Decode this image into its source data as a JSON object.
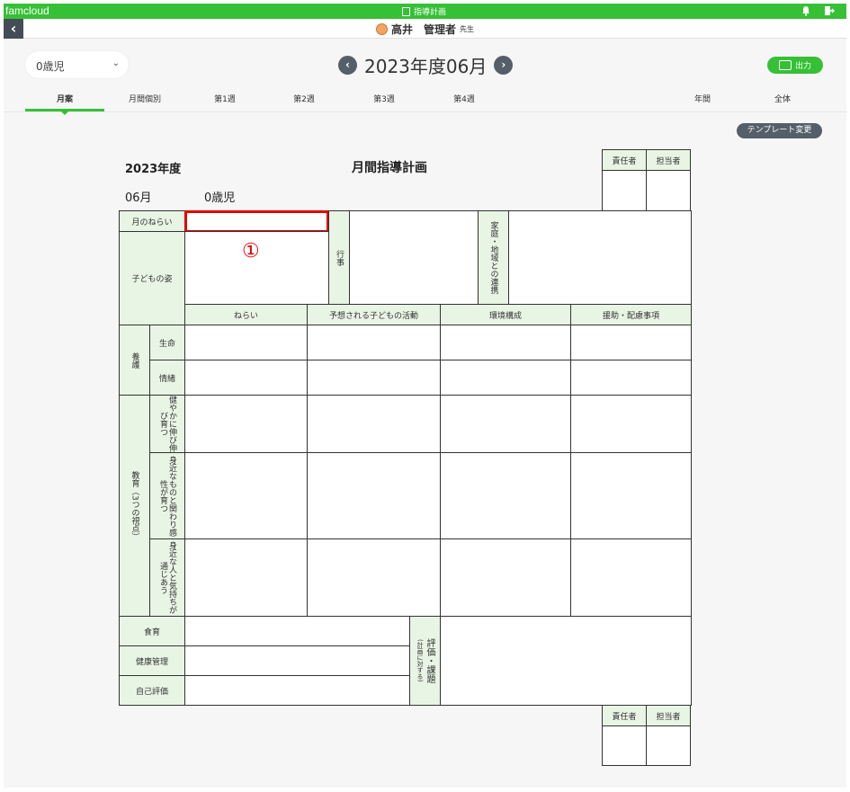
{
  "topbar": {
    "brand": "famcloud",
    "page_label": "指導計画",
    "bell_icon": "bell-icon",
    "logout_icon": "logout-icon",
    "color": "#36c036"
  },
  "userbar": {
    "back_icon": "back-arrow-icon",
    "name": "高井　管理者",
    "honorific": "先生"
  },
  "toolbar": {
    "class_select": "0歳児",
    "prev_icon": "chevron-left-icon",
    "next_icon": "chevron-right-icon",
    "month_title": "2023年度06月",
    "print_label": "出力",
    "template_button": "テンプレート変更"
  },
  "tabs": [
    "月案",
    "月間個別",
    "第1週",
    "第2週",
    "第3週",
    "第4週",
    "年間",
    "全体"
  ],
  "active_tab": "月案",
  "doc": {
    "year": "2023年度",
    "title": "月間指導計画",
    "month": "06月",
    "class": "0歳児",
    "sign_labels": [
      "責任者",
      "担当者"
    ],
    "monthly_aim": "月のねらい",
    "child_profile": "子どもの姿",
    "events": "行事",
    "family": "家庭・地域との連携",
    "marker": "①",
    "columns": [
      "ねらい",
      "予想される子どもの活動",
      "環境構成",
      "援助・配慮事項"
    ],
    "care": "養護",
    "care_rows": [
      "生命",
      "情緒"
    ],
    "education": "教育（3つの視点）",
    "edu_rows": [
      "健やかに伸び伸び育つ",
      "身近なものと関わり感性が育つ",
      "身近な人と気持ちが通じあう"
    ],
    "bottom_rows": [
      "食育",
      "健康管理",
      "自己評価"
    ],
    "evaluation": "評価・課題",
    "evaluation_sub": "(計画に対する)"
  }
}
